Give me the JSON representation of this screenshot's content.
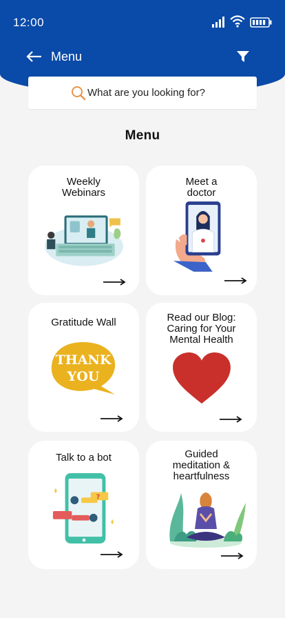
{
  "status_bar": {
    "time": "12:00"
  },
  "nav": {
    "title": "Menu"
  },
  "search": {
    "placeholder": "What are you looking for?"
  },
  "page": {
    "title": "Menu"
  },
  "cards": [
    {
      "label": "Weekly\nWebinars",
      "icon": "webinar-illustration"
    },
    {
      "label": "Meet a\ndoctor",
      "icon": "doctor-phone-illustration"
    },
    {
      "label": "Gratitude Wall",
      "icon": "thank-you-bubble-illustration",
      "art_text_1": "THANK",
      "art_text_2": "YOU"
    },
    {
      "label": "Read our Blog:\nCaring for Your\nMental Health",
      "icon": "heart-illustration"
    },
    {
      "label": "Talk to a bot",
      "icon": "chatbot-phone-illustration"
    },
    {
      "label": "Guided\nmeditation &\nheartfulness",
      "icon": "meditation-illustration"
    }
  ],
  "colors": {
    "header": "#0a4aa8",
    "background": "#f4f4f4",
    "card": "#ffffff",
    "search_icon": "#e8944a",
    "heart": "#c9302c"
  }
}
